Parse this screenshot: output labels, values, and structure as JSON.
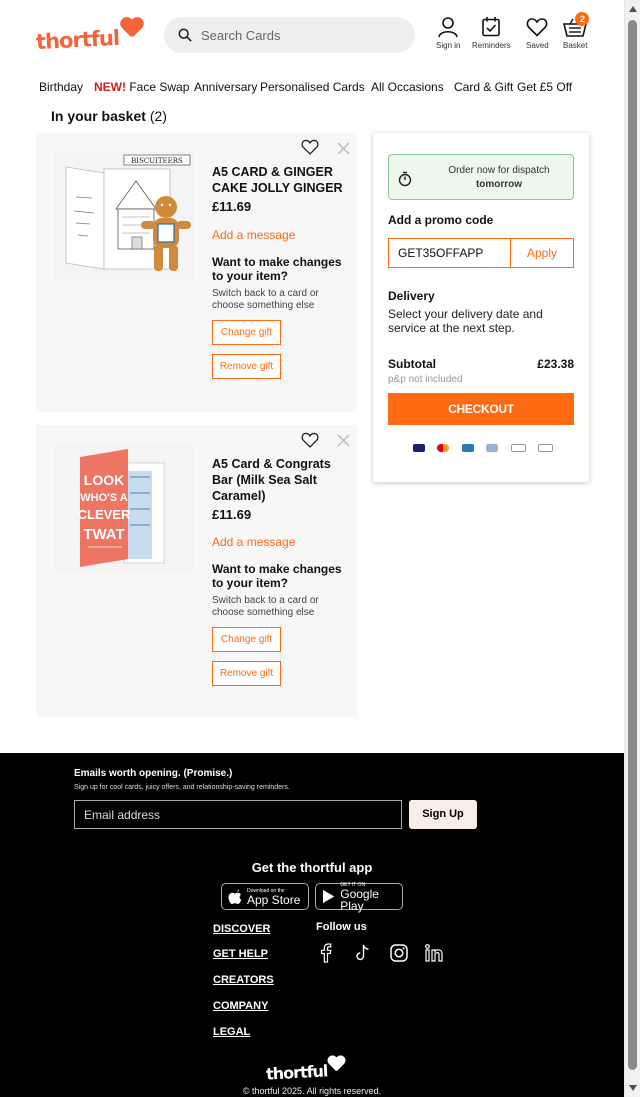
{
  "header": {
    "logo_text": "thortful",
    "search_placeholder": "Search Cards",
    "icons": [
      {
        "name": "sign-in-icon",
        "label": "Sign in"
      },
      {
        "name": "reminders-icon",
        "label": "Reminders"
      },
      {
        "name": "heart-icon",
        "label": "Saved"
      },
      {
        "name": "basket-icon",
        "label": "Basket"
      }
    ],
    "basket_count": "2"
  },
  "nav": {
    "items": [
      "Birthday",
      "Face Swap",
      "Anniversary",
      "Personalised Cards",
      "All Occasions",
      "Card & Gift",
      "Get £5 Off"
    ],
    "new_label": "NEW!"
  },
  "basket": {
    "title": "In your basket",
    "count": "(2)"
  },
  "items": [
    {
      "title": "A5 CARD & GINGER CAKE JOLLY GINGER",
      "price": "£11.69",
      "add_message": "Add a message",
      "want_changes": "Want to make changes to your item?",
      "switch_text": "Switch back to a card or choose something else",
      "change_label": "Change gift",
      "remove_label": "Remove gift",
      "image_brand": "BISCUITEERS"
    },
    {
      "title": "A5 Card & Congrats Bar (Milk Sea Salt Caramel)",
      "price": "£11.69",
      "add_message": "Add a message",
      "want_changes": "Want to make changes to your item?",
      "switch_text": "Switch back to a card or choose something else",
      "change_label": "Change gift",
      "remove_label": "Remove gift",
      "image_lines": [
        "LOOK",
        "WHO'S A",
        "CLEVER",
        "TWAT"
      ]
    }
  ],
  "summary": {
    "dispatch_line1": "Order now for dispatch",
    "dispatch_line2": "tomorrow",
    "promo_label": "Add a promo code",
    "promo_value": "GET35OFFAPP",
    "apply_label": "Apply",
    "delivery_label": "Delivery",
    "delivery_text": "Select your delivery date and service at the next step.",
    "subtotal_label": "Subtotal",
    "subtotal_value": "£23.38",
    "pp_note": "p&p not included",
    "checkout_label": "CHECKOUT",
    "payment_icons": [
      "visa-icon",
      "mastercard-icon",
      "amex-icon",
      "paypal-icon",
      "apple-pay-icon",
      "google-pay-icon"
    ]
  },
  "footer": {
    "email_heading": "Emails worth opening. (Promise.)",
    "email_sub": "Sign up for cool cards, juicy offers, and relationship-saving reminders.",
    "email_placeholder": "Email address",
    "signup_label": "Sign Up",
    "app_heading": "Get the thortful app",
    "app_store_small": "Download on the",
    "app_store_big": "App Store",
    "google_small": "GET IT ON",
    "google_big": "Google Play",
    "links": [
      "DISCOVER",
      "GET HELP",
      "CREATORS",
      "COMPANY",
      "LEGAL"
    ],
    "follow_label": "Follow us",
    "social": [
      "facebook-icon",
      "tiktok-icon",
      "instagram-icon",
      "linkedin-icon"
    ],
    "logo_text": "thortful",
    "copyright": "© thortful 2025. All rights reserved."
  },
  "colors": {
    "brand_orange": "#ff6a13",
    "logo_coral": "#f4633a",
    "footer_bg": "#000000",
    "dispatch_bg": "#eef7ee"
  }
}
